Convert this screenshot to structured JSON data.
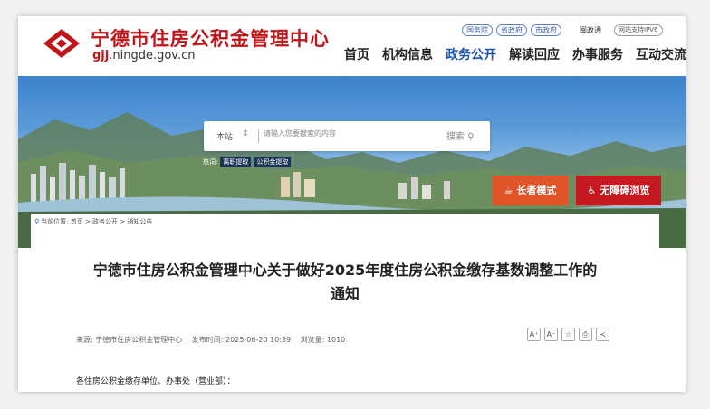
{
  "header": {
    "site_name": "宁德市住房公积金管理中心",
    "domain_prefix": "gjj",
    "domain_rest": ".ningde.gov.cn",
    "gov_links": [
      "国务院",
      "省政府",
      "市政府"
    ],
    "mintong": "闽政通",
    "ipv6": "网站支持IPV6",
    "nav": [
      "首页",
      "机构信息",
      "政务公开",
      "解读回应",
      "办事服务",
      "互动交流"
    ],
    "active_nav": "政务公开"
  },
  "search": {
    "scope": "本站",
    "placeholder": "请输入您要搜索的内容",
    "button": "搜索"
  },
  "hot": {
    "label": "热词:",
    "tags": [
      "离职提取",
      "公积金提取"
    ]
  },
  "assist": {
    "elder_mode": "长者模式",
    "accessible": "无障碍浏览"
  },
  "breadcrumb": {
    "label": "当前位置:",
    "path": "首页 > 政务公开 > 通知公告"
  },
  "article": {
    "title_line1": "宁德市住房公积金管理中心关于做好2025年度住房公积金缴存基数调整工作的",
    "title_line2": "通知",
    "source": "来源: 宁德市住房公积金管理中心",
    "published": "发布时间: 2025-06-20 10:39",
    "views": "浏览量: 1010",
    "greeting": "各住房公积金缴存单位、办事处（营业部）："
  },
  "tools": [
    "A⁺",
    "A⁻",
    "☆",
    "⎙",
    "≺"
  ],
  "colors": {
    "brand_red": "#c0161a",
    "nav_active": "#1e55b3",
    "elder_orange": "#e0542a",
    "access_red": "#c51a22"
  }
}
